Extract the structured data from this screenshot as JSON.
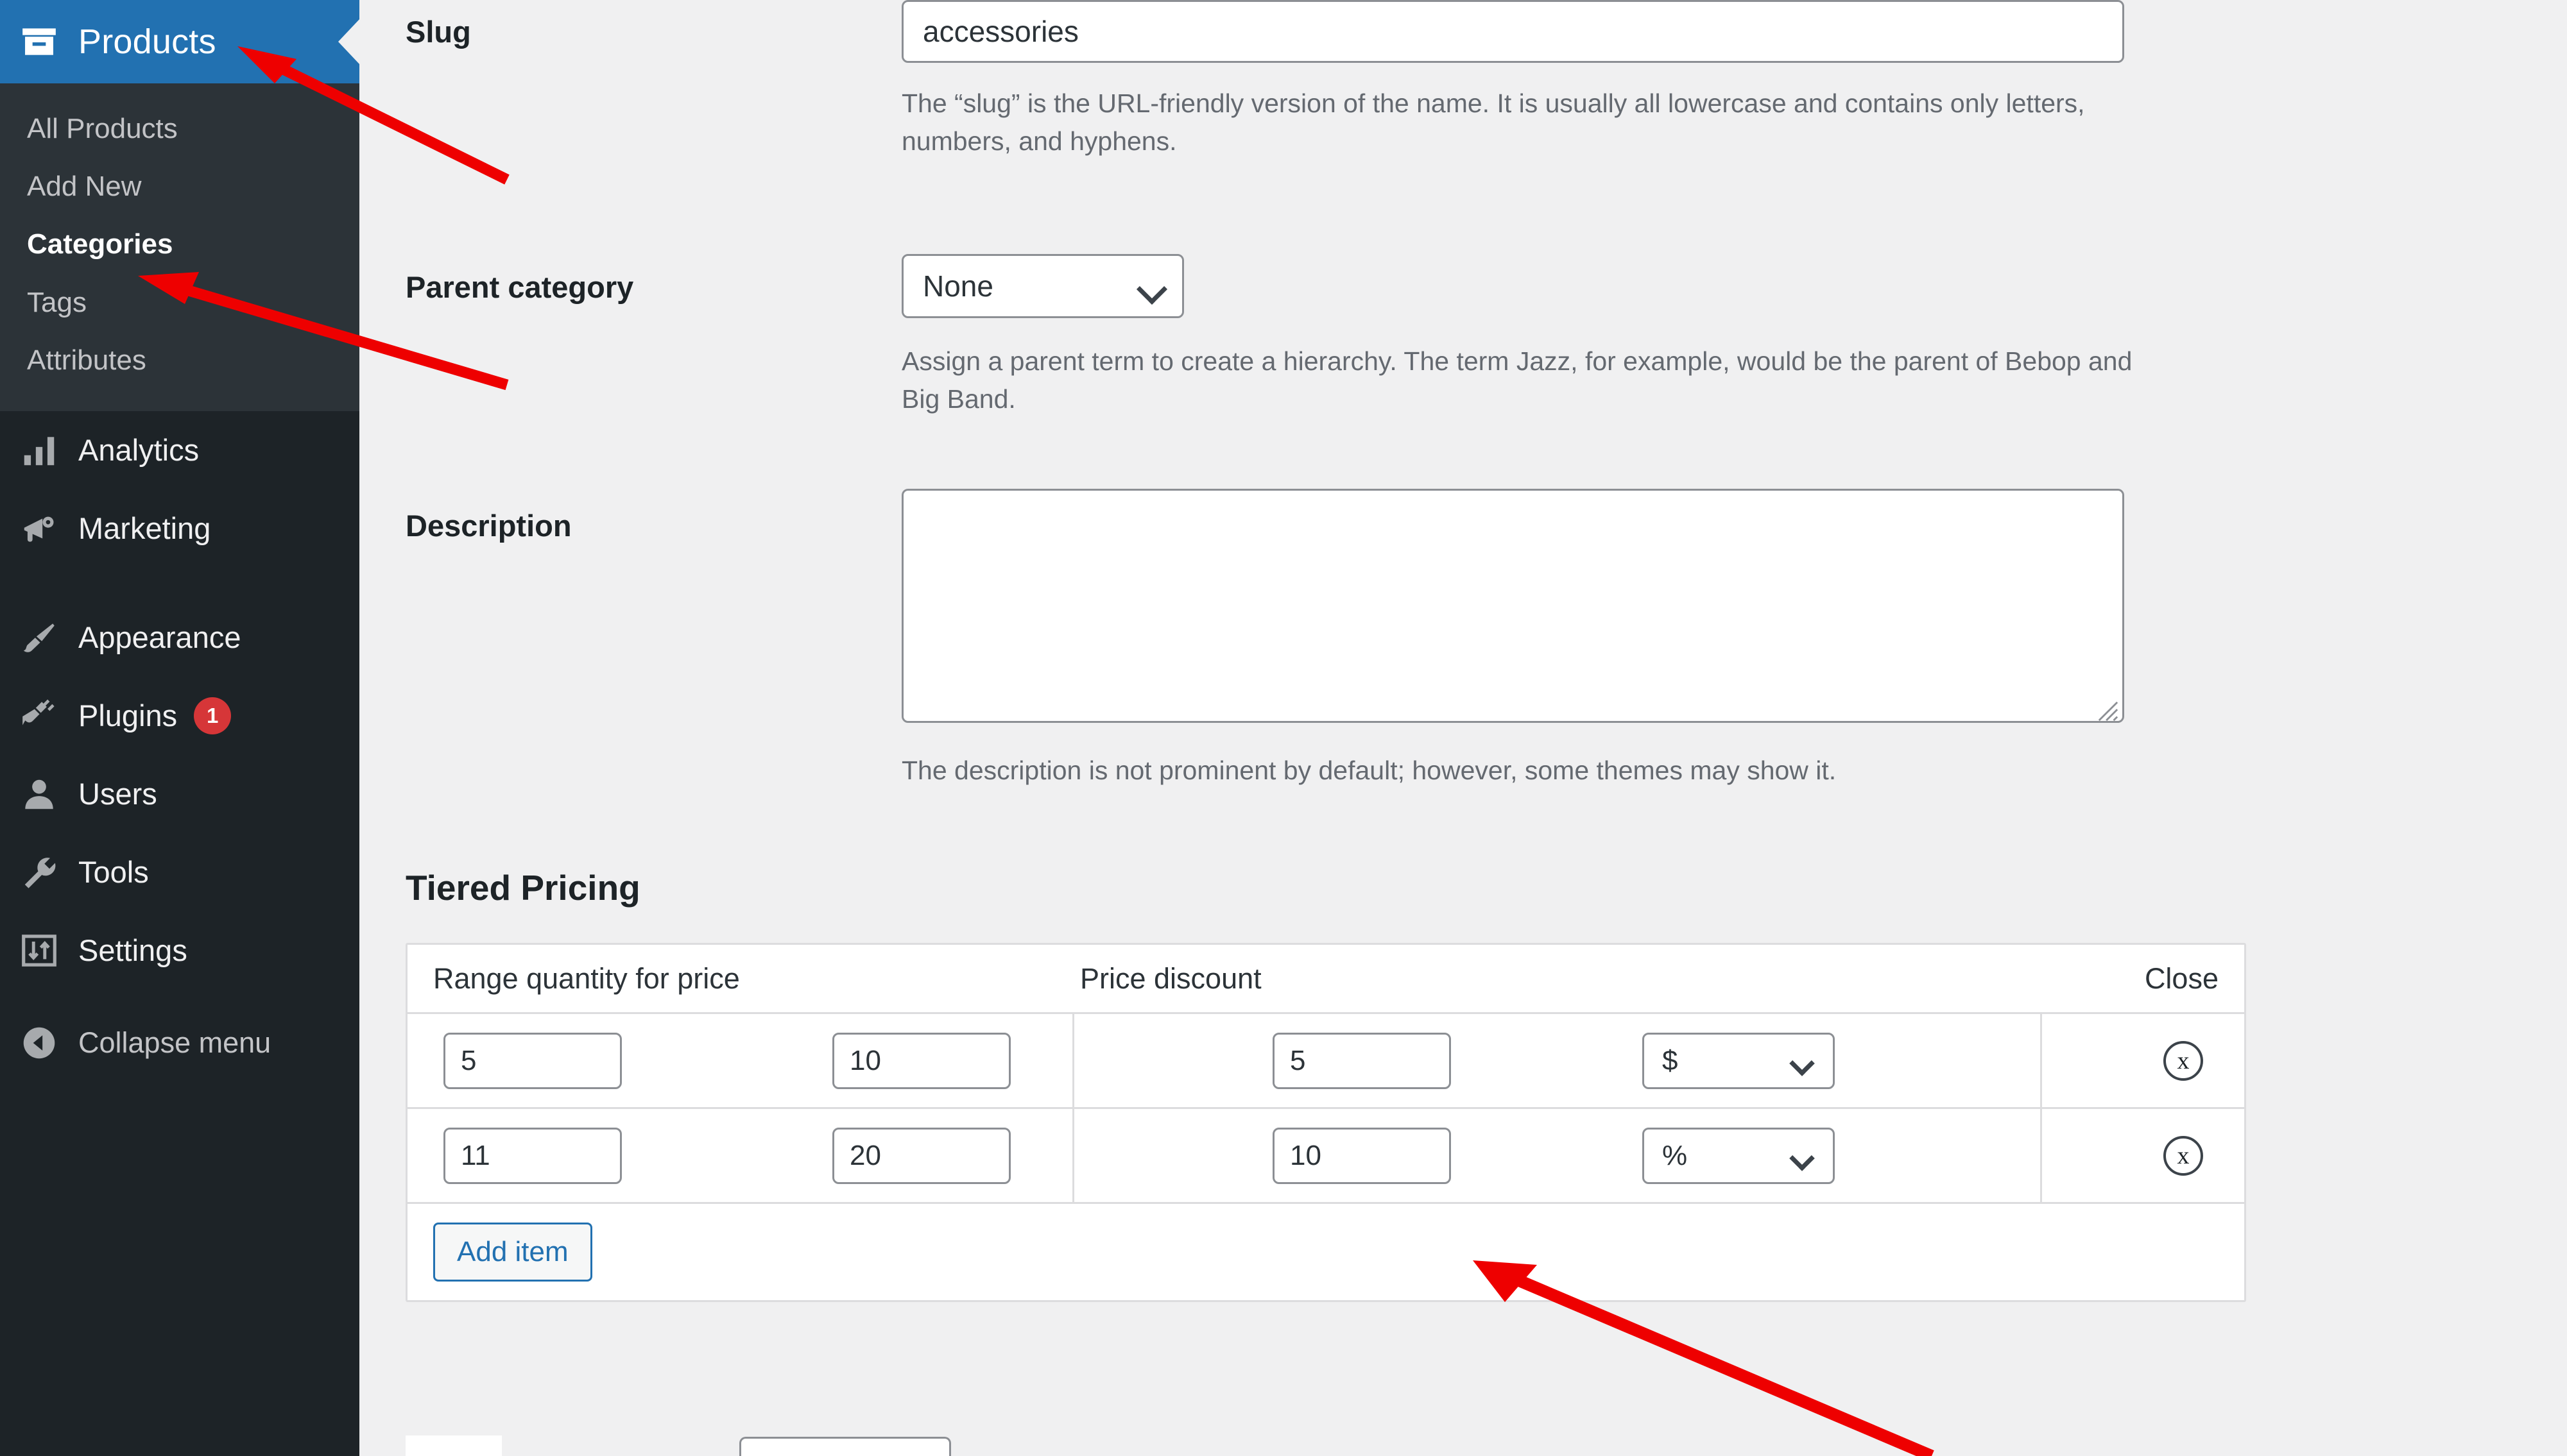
{
  "sidebar": {
    "current_menu": {
      "label": "Products",
      "icon": "products-box-icon"
    },
    "submenu": [
      {
        "label": "All Products",
        "current": false
      },
      {
        "label": "Add New",
        "current": false
      },
      {
        "label": "Categories",
        "current": true
      },
      {
        "label": "Tags",
        "current": false
      },
      {
        "label": "Attributes",
        "current": false
      }
    ],
    "items": [
      {
        "label": "Analytics",
        "icon": "bar-chart-icon",
        "badge": ""
      },
      {
        "label": "Marketing",
        "icon": "megaphone-icon",
        "badge": ""
      },
      {
        "label": "Appearance",
        "icon": "paintbrush-icon",
        "badge": ""
      },
      {
        "label": "Plugins",
        "icon": "plug-icon",
        "badge": "1"
      },
      {
        "label": "Users",
        "icon": "user-icon",
        "badge": ""
      },
      {
        "label": "Tools",
        "icon": "wrench-icon",
        "badge": ""
      },
      {
        "label": "Settings",
        "icon": "settings-sliders-icon",
        "badge": ""
      }
    ],
    "collapse": {
      "label": "Collapse menu",
      "icon": "collapse-arrow-icon"
    },
    "colors": {
      "background": "#1d2327",
      "submenu_background": "#2c3338",
      "current_highlight": "#2271b1",
      "badge": "#d63638"
    }
  },
  "form": {
    "slug": {
      "label": "Slug",
      "value": "accessories",
      "placeholder": "",
      "help": "The “slug” is the URL-friendly version of the name. It is usually all lowercase and contains only letters, numbers, and hyphens."
    },
    "parent_category": {
      "label": "Parent category",
      "selected": "None",
      "options": [
        "None"
      ],
      "help": "Assign a parent term to create a hierarchy. The term Jazz, for example, would be the parent of Bebop and Big Band."
    },
    "description": {
      "label": "Description",
      "value": "",
      "placeholder": "",
      "help": "The description is not prominent by default; however, some themes may show it."
    }
  },
  "tiered_pricing": {
    "title": "Tiered Pricing",
    "headers": {
      "range": "Range quantity for price",
      "discount": "Price discount",
      "close": "Close"
    },
    "rows": [
      {
        "range_min": "5",
        "range_max": "10",
        "discount": "5",
        "unit": "$",
        "unit_options": [
          "$",
          "%"
        ],
        "delete_icon": "circle-x-icon"
      },
      {
        "range_min": "11",
        "range_max": "20",
        "discount": "10",
        "unit": "%",
        "unit_options": [
          "$",
          "%"
        ],
        "delete_icon": "circle-x-icon"
      }
    ],
    "add_item_label": "Add item"
  },
  "annotations": {
    "color": "#ee0000",
    "arrows": [
      {
        "name": "arrow-to-products",
        "target": "Products"
      },
      {
        "name": "arrow-to-categories",
        "target": "Categories"
      },
      {
        "name": "arrow-to-tiered-pricing",
        "target": "Tiered Pricing table"
      }
    ]
  }
}
